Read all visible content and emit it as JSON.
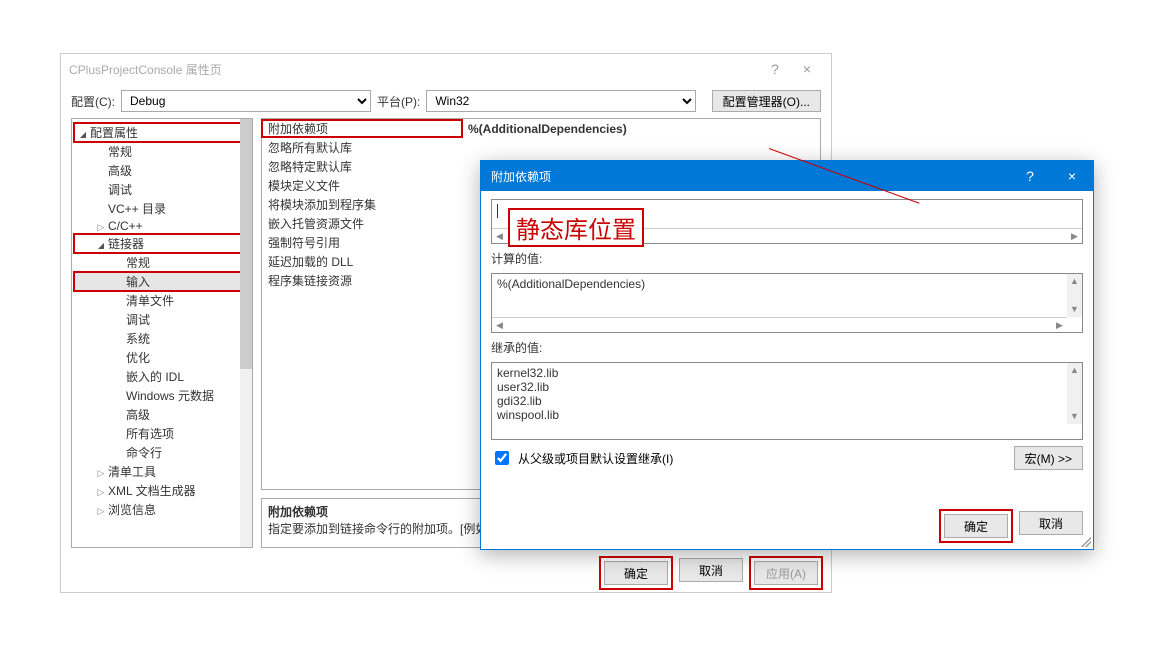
{
  "main_window": {
    "title": "CPlusProjectConsole 属性页",
    "help_tooltip": "?",
    "close_tooltip": "×",
    "config_label": "配置(C):",
    "config_value": "Debug",
    "platform_label": "平台(P):",
    "platform_value": "Win32",
    "config_manager_btn": "配置管理器(O)..."
  },
  "tree": [
    {
      "label": "配置属性",
      "indent": 0,
      "tri": "open",
      "red": true
    },
    {
      "label": "常规",
      "indent": 1,
      "tri": "blank"
    },
    {
      "label": "高级",
      "indent": 1,
      "tri": "blank"
    },
    {
      "label": "调试",
      "indent": 1,
      "tri": "blank"
    },
    {
      "label": "VC++ 目录",
      "indent": 1,
      "tri": "blank"
    },
    {
      "label": "C/C++",
      "indent": 1,
      "tri": "closed"
    },
    {
      "label": "链接器",
      "indent": 1,
      "tri": "open",
      "red": true
    },
    {
      "label": "常规",
      "indent": 2,
      "tri": "blank"
    },
    {
      "label": "输入",
      "indent": 2,
      "tri": "blank",
      "red": true,
      "sel": true
    },
    {
      "label": "清单文件",
      "indent": 2,
      "tri": "blank"
    },
    {
      "label": "调试",
      "indent": 2,
      "tri": "blank"
    },
    {
      "label": "系统",
      "indent": 2,
      "tri": "blank"
    },
    {
      "label": "优化",
      "indent": 2,
      "tri": "blank"
    },
    {
      "label": "嵌入的 IDL",
      "indent": 2,
      "tri": "blank"
    },
    {
      "label": "Windows 元数据",
      "indent": 2,
      "tri": "blank"
    },
    {
      "label": "高级",
      "indent": 2,
      "tri": "blank"
    },
    {
      "label": "所有选项",
      "indent": 2,
      "tri": "blank"
    },
    {
      "label": "命令行",
      "indent": 2,
      "tri": "blank"
    },
    {
      "label": "清单工具",
      "indent": 1,
      "tri": "closed"
    },
    {
      "label": "XML 文档生成器",
      "indent": 1,
      "tri": "closed"
    },
    {
      "label": "浏览信息",
      "indent": 1,
      "tri": "closed"
    }
  ],
  "props": [
    {
      "name": "附加依赖项",
      "value": "%(AdditionalDependencies)"
    },
    {
      "name": "忽略所有默认库",
      "value": ""
    },
    {
      "name": "忽略特定默认库",
      "value": ""
    },
    {
      "name": "模块定义文件",
      "value": ""
    },
    {
      "name": "将模块添加到程序集",
      "value": ""
    },
    {
      "name": "嵌入托管资源文件",
      "value": ""
    },
    {
      "name": "强制符号引用",
      "value": ""
    },
    {
      "name": "延迟加载的 DLL",
      "value": ""
    },
    {
      "name": "程序集链接资源",
      "value": ""
    }
  ],
  "desc": {
    "title": "附加依赖项",
    "text": "指定要添加到链接命令行的附加项。[例如"
  },
  "main_btns": {
    "ok": "确定",
    "cancel": "取消",
    "apply": "应用(A)"
  },
  "edit_dialog": {
    "title": "附加依赖项",
    "help": "?",
    "close": "×",
    "input_value": "",
    "computed_label": "计算的值:",
    "computed_value": "%(AdditionalDependencies)",
    "inherited_label": "继承的值:",
    "inherited_values": [
      "kernel32.lib",
      "user32.lib",
      "gdi32.lib",
      "winspool.lib"
    ],
    "inherit_checkbox": "从父级或项目默认设置继承(I)",
    "macro_btn": "宏(M) >>",
    "ok": "确定",
    "cancel": "取消"
  },
  "annotation": "静态库位置"
}
